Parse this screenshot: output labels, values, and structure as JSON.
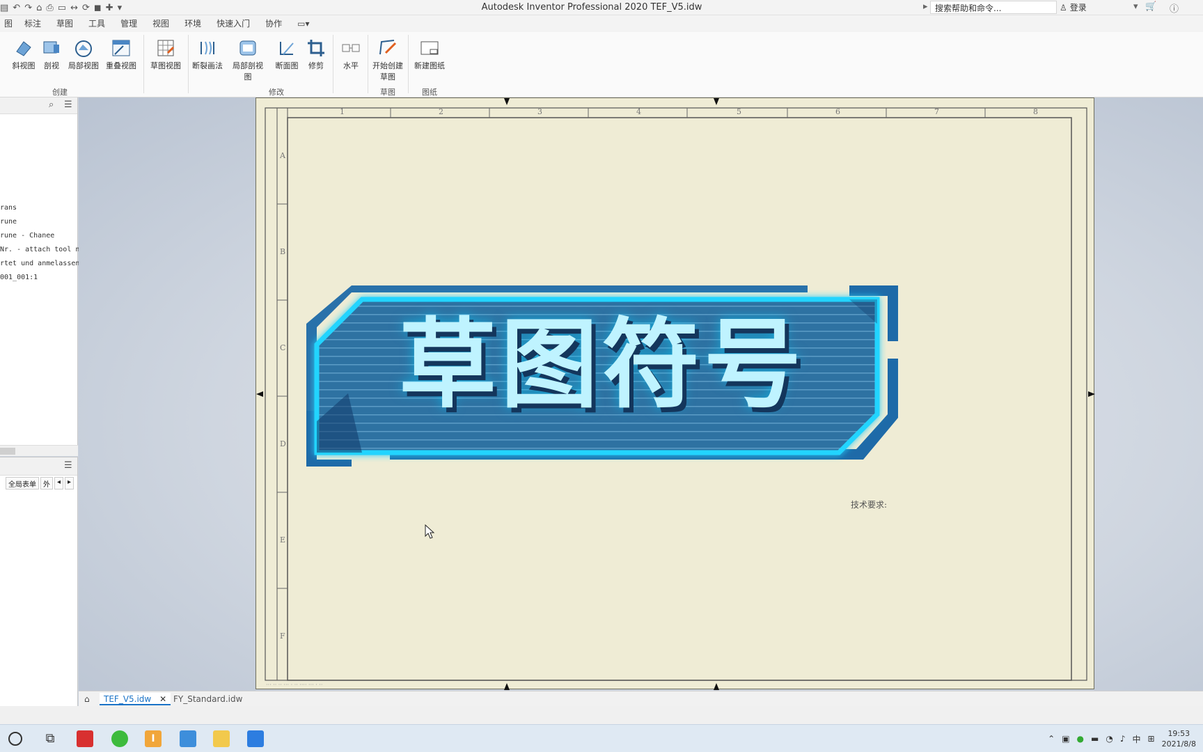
{
  "app": {
    "title": "Autodesk Inventor Professional 2020    TEF_V5.idw",
    "search_placeholder": "搜索帮助和命令...",
    "login_label": "登录"
  },
  "menu_tabs": [
    "标注",
    "草图",
    "工具",
    "管理",
    "视图",
    "环境",
    "快速入门",
    "协作"
  ],
  "ribbon": {
    "groups": [
      {
        "label": "创建",
        "buttons": [
          "斜视图",
          "剖视",
          "局部视图",
          "重叠视图"
        ]
      },
      {
        "label": "",
        "buttons": [
          "草图视图"
        ]
      },
      {
        "label": "修改",
        "buttons": [
          "断裂画法",
          "局部剖视图",
          "断面图",
          "修剪"
        ]
      },
      {
        "label": "",
        "buttons": [
          "水平"
        ]
      },
      {
        "label": "草图",
        "buttons": [
          "开始创建草图"
        ]
      },
      {
        "label": "图纸",
        "buttons": [
          "新建图纸"
        ]
      }
    ]
  },
  "browser": {
    "nodes": [
      "rans",
      "rune",
      "rune - Chanee",
      "Nr. - attach tool n",
      "rtet und anmelassen",
      "001_001:1"
    ]
  },
  "props": {
    "tab1": "全局表单",
    "tab2": "外"
  },
  "sheet": {
    "col_labels": [
      "1",
      "2",
      "3",
      "4",
      "5",
      "6",
      "7",
      "8"
    ],
    "row_labels": [
      "A",
      "B",
      "C",
      "D",
      "E",
      "F"
    ],
    "tech_requirements": "技术要求:"
  },
  "overlay": {
    "title": "草图符号"
  },
  "doc_tabs": {
    "active": "TEF_V5.idw",
    "other": "FY_Standard.idw"
  },
  "taskbar": {
    "ime": "中",
    "time": "19:53",
    "date": "2021/8/8"
  },
  "colors": {
    "sheet_bg": "#efecd5",
    "banner_glow": "#21d4ff",
    "banner_fill": "#2c6f9e",
    "title_text": "#bff3ff"
  }
}
